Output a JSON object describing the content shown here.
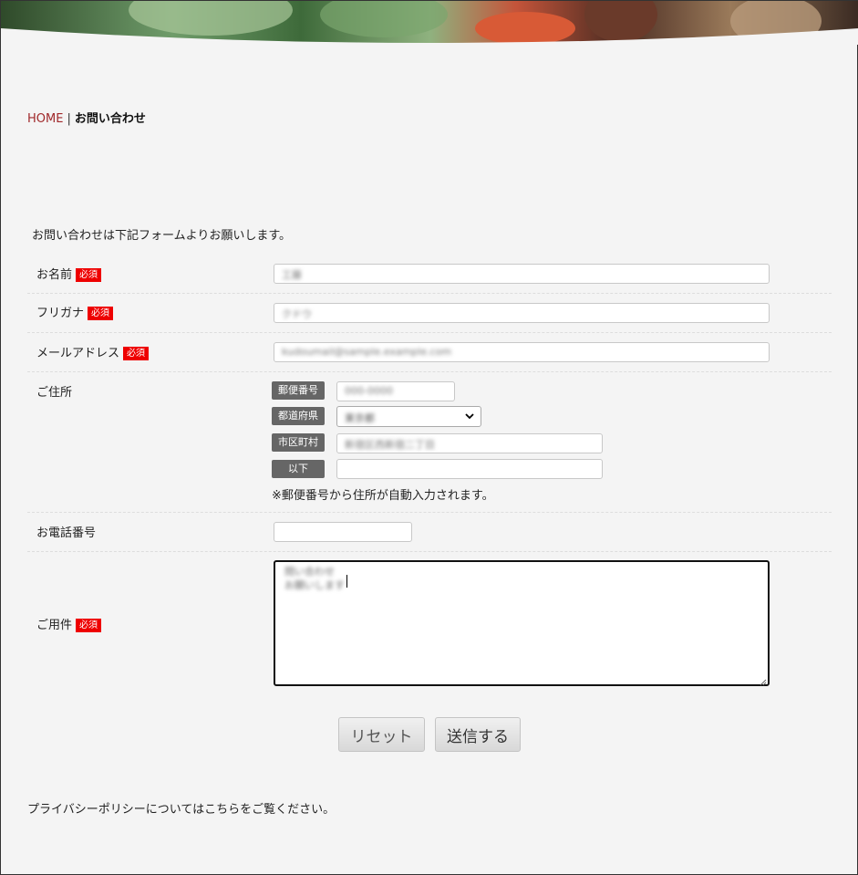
{
  "breadcrumb": {
    "home": "HOME",
    "separator": "|",
    "current": "お問い合わせ"
  },
  "intro": "お問い合わせは下記フォームよりお願いします。",
  "required_badge": "必須",
  "fields": {
    "name": {
      "label": "お名前",
      "value": "工藤"
    },
    "furigana": {
      "label": "フリガナ",
      "value": "クドウ"
    },
    "email": {
      "label": "メールアドレス",
      "value": "kudoumail@sample.example.com"
    },
    "address": {
      "label": "ご住所",
      "postal_tag": "郵便番号",
      "postal_value": "000-0000",
      "prefecture_tag": "都道府県",
      "prefecture_value": "東京都",
      "city_tag": "市区町村",
      "city_value": "新宿区西新宿二丁目",
      "below_tag": "以下",
      "below_value": "",
      "note": "※郵便番号から住所が自動入力されます。"
    },
    "phone": {
      "label": "お電話番号",
      "value": ""
    },
    "inquiry": {
      "label": "ご用件",
      "value": "問い合わせ\nお願いします"
    }
  },
  "buttons": {
    "reset": "リセット",
    "submit": "送信する"
  },
  "privacy": "プライバシーポリシーについてはこちらをご覧ください。",
  "colors": {
    "accent": "#a0282a",
    "required": "#e00000",
    "tag": "#666666",
    "background": "#f4f4f4"
  }
}
